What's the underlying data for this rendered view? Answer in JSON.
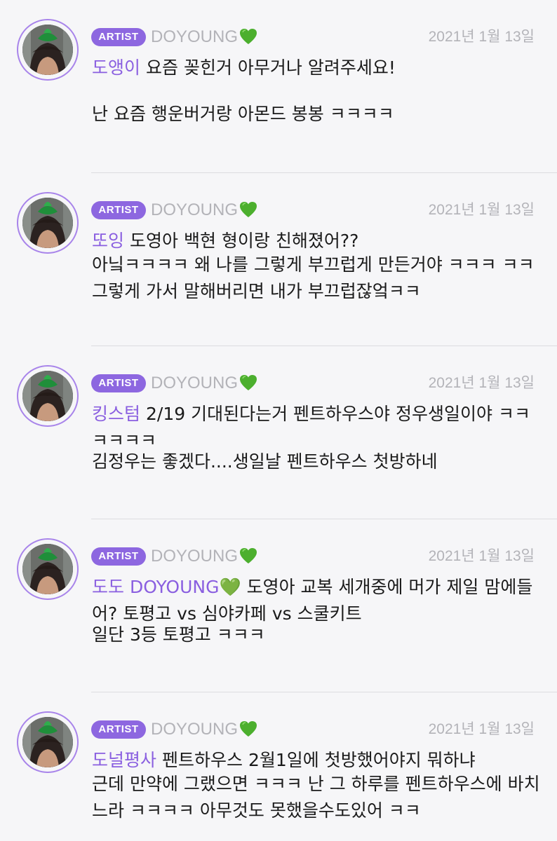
{
  "posts": [
    {
      "badge": "ARTIST",
      "author": "DOYOUNG",
      "date": "2021년 1월 13일",
      "fan_name": "도앵이",
      "question": "요즘 꽂힌거 아무거나 알려주세요!",
      "reply": "난 요즘 행운버거랑 아몬드 봉봉 ㅋㅋㅋㅋ"
    },
    {
      "badge": "ARTIST",
      "author": "DOYOUNG",
      "date": "2021년 1월 13일",
      "fan_name": "또잉",
      "question": "도영아 백현 형이랑 친해졌어??",
      "reply": "아닠ㅋㅋㅋㅋ 왜 나를 그렇게 부끄럽게 만든거야 ㅋㅋㅋ ㅋㅋ그렇게 가서 말해버리면 내가 부끄럽잖엌ㅋㅋ"
    },
    {
      "badge": "ARTIST",
      "author": "DOYOUNG",
      "date": "2021년 1월 13일",
      "fan_name": "킹스텀",
      "question": "2/19 기대된다는거 펜트하우스야 정우생일이야 ㅋㅋㅋㅋㅋㅋ",
      "reply": "김정우는 좋겠다....생일날 펜트하우스 첫방하네"
    },
    {
      "badge": "ARTIST",
      "author": "DOYOUNG",
      "date": "2021년 1월 13일",
      "fan_name": "도도 DOYOUNG💚",
      "question": "도영아 교복 세개중에 머가 제일 맘에들어? 토평고 vs 심야카페 vs 스쿨키트",
      "reply": "일단 3등 토평고 ㅋㅋㅋ"
    },
    {
      "badge": "ARTIST",
      "author": "DOYOUNG",
      "date": "2021년 1월 13일",
      "fan_name": "도널평사",
      "question": "펜트하우스 2월1일에 첫방했어야지 뭐하냐",
      "reply": "근데 만약에 그랬으면 ㅋㅋㅋ 난 그 하루를 펜트하우스에 바치느라 ㅋㅋㅋㅋ 아무것도 못했을수도있어 ㅋㅋ"
    }
  ],
  "colors": {
    "accent": "#8d67e0",
    "fan_name": "#8a5fe0",
    "meta_gray": "#b3b3b8",
    "heart": "#4caf2e",
    "background": "#f6f6f8"
  },
  "icons": {
    "heart": "green-heart-icon"
  }
}
